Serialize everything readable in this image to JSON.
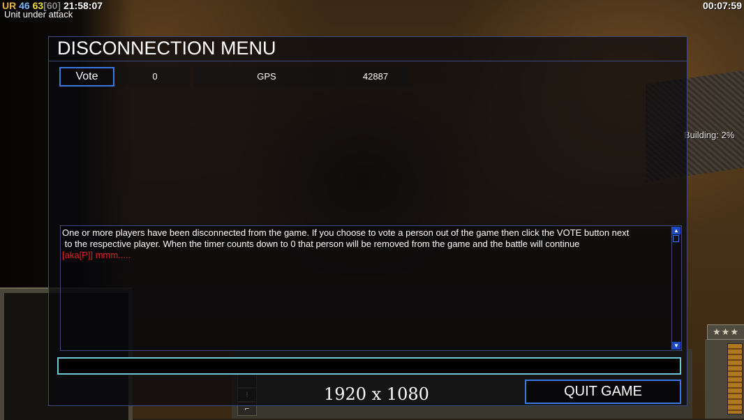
{
  "hud": {
    "ur": "UR",
    "stat_a": "46",
    "stat_b": "63",
    "stat_c": "[60]",
    "clock": "21:58:07",
    "alert": "Unit under attack",
    "elapsed": "00:07:59"
  },
  "world": {
    "building_progress": "Building: 2%",
    "rank_stars": "★★★"
  },
  "dialog": {
    "title": "DISCONNECTION MENU",
    "vote_label": "Vote",
    "votes": "0",
    "player": "GPS",
    "timer": "42887",
    "chat_lines": [
      "One or more players have been disconnected from the game. If you choose to vote a person out of the game then click the VOTE button next",
      " to the respective player. When the timer counts down to 0 that person will be removed from the game and the battle will continue"
    ],
    "chat_message": "[aka[P]] mmm.....",
    "chat_input_value": "",
    "resolution": "1920 x 1080",
    "quit_label": "QUIT GAME"
  },
  "icons": {
    "scroll_up": "triangle-up",
    "scroll_down": "triangle-down"
  },
  "colors": {
    "accent_blue": "#3b78e0",
    "input_border": "#6ec8d8",
    "message_red": "#e42020"
  }
}
